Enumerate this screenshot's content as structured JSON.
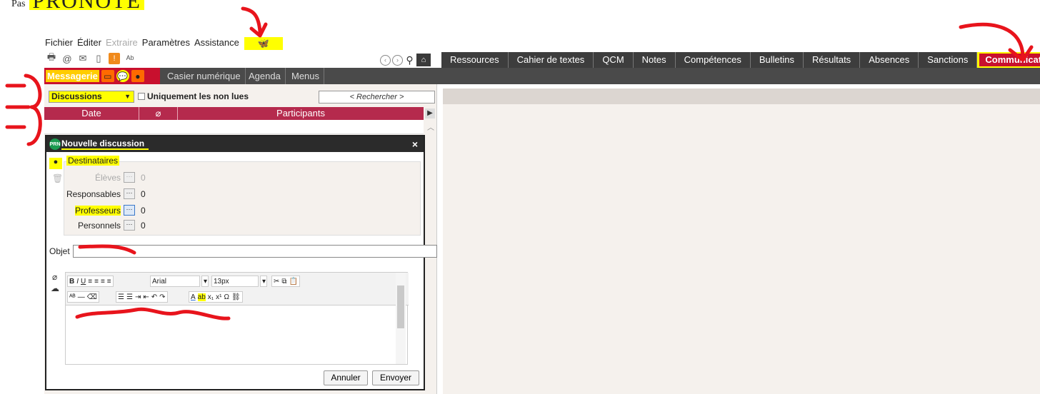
{
  "clipped_heading": {
    "small": "Pas",
    "big": "PRONOTE"
  },
  "menubar": {
    "items": [
      "Fichier",
      "Éditer",
      "Extraire",
      "Paramètres",
      "Assistance"
    ]
  },
  "top_tabs": [
    "Ressources",
    "Cahier de textes",
    "QCM",
    "Notes",
    "Compétences",
    "Bulletins",
    "Résultats",
    "Absences",
    "Sanctions",
    "Communication"
  ],
  "sub_bar": {
    "active": "Messagerie",
    "tabs": [
      "Casier numérique",
      "Agenda",
      "Menus"
    ]
  },
  "list": {
    "filter": "Discussions",
    "unread_label": "Uniquement les non lues",
    "search_placeholder": "< Rechercher >",
    "columns": [
      "Date",
      "",
      "Participants"
    ]
  },
  "dialog": {
    "logo": "PRN",
    "title": "Nouvelle discussion",
    "close": "×",
    "destinataires_label": "Destinataires",
    "recipients": [
      {
        "label": "Élèves",
        "count": "0"
      },
      {
        "label": "Responsables",
        "count": "0"
      },
      {
        "label": "Professeurs",
        "count": "0"
      },
      {
        "label": "Personnels",
        "count": "0"
      }
    ],
    "objet_label": "Objet",
    "editor": {
      "font": "Arial",
      "size": "13px"
    },
    "cancel_label": "Annuler",
    "send_label": "Envoyer"
  },
  "colors": {
    "accent": "#c8102e",
    "list_header": "#b52a4d",
    "highlight": "#ffff00"
  }
}
